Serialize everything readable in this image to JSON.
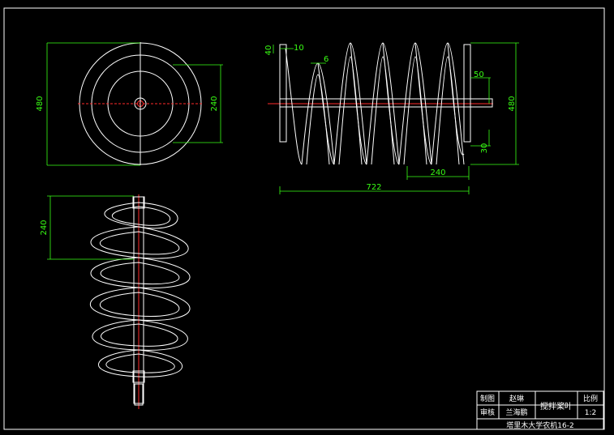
{
  "drawing": {
    "front_view": {
      "dim_height": "480",
      "dim_inner": "240"
    },
    "side_view": {
      "dim_flange": "40",
      "dim_flange_w": "10",
      "dim_thick": "6",
      "dim_pitch": "50",
      "dim_height": "480",
      "dim_small": "30",
      "dim_span": "240",
      "dim_total": "722"
    },
    "iso_view": {
      "dim_pitch": "240"
    },
    "title_block": {
      "row1_label": "制图",
      "row1_name": "赵琳",
      "row2_label": "审核",
      "row2_name": "兰海鹏",
      "part_name": "搅拌桨叶",
      "scale_label": "比例",
      "scale_value": "1:2",
      "institution": "塔里木大学农机16-2"
    }
  },
  "colors": {
    "background": "#000000",
    "line": "#ffffff",
    "dimension": "#39ff14",
    "axis": "#ff2a2a"
  }
}
